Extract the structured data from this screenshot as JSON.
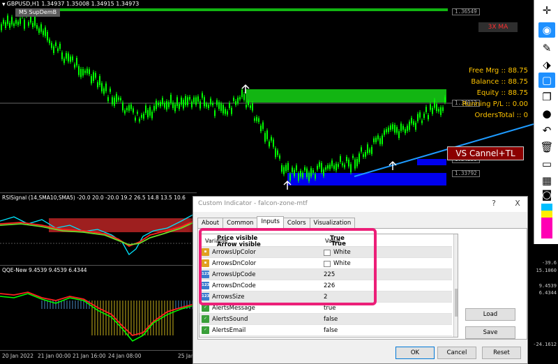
{
  "chart": {
    "header": "GBPUSD,H1  1.34937 1.35008 1.34915 1.34973",
    "sup_label": "M5 SupDemB",
    "ma_label": "3X MA",
    "price_tags": [
      "1.36549",
      "1.34913",
      "1.34250",
      "1.33792"
    ],
    "account": {
      "free_margin": "Free Mrg  :: 88.75",
      "balance": "Balance :: 88.75",
      "equity": "Equity :: 88.75",
      "running_pl": "Running P/L :: 0.00",
      "orders_total": "OrdersTotal :: 0"
    },
    "vs_label": "VS Cannel+TL",
    "colors": {
      "zone_green": "#12b512",
      "zone_blue": "#0000ee",
      "candle": "#00ff00",
      "trendline": "#1e9bff",
      "account_text": "#ffc400"
    }
  },
  "subwindows": {
    "rsi_title": "RSISignal (14,SMA10,SMA5) -20.0 20.0 -20.0 19.2 26.5 14.8 13.5 10.6",
    "qqe_title": "QQE-New 9.4539 9.4539 6.4344"
  },
  "price_axis": [
    "-39.6",
    "15.1060",
    "9.4539",
    "6.4344",
    "-24.1612"
  ],
  "time_axis": [
    "20 Jan 2022",
    "21 Jan 00:00",
    "21 Jan 16:00",
    "24 Jan 08:00",
    "25 Jan"
  ],
  "dialog": {
    "title": "Custom Indicator - falcon-zone-mtf",
    "controls": {
      "help": "?",
      "close": "X"
    },
    "tabs": [
      "About",
      "Common",
      "Inputs",
      "Colors",
      "Visualization"
    ],
    "grid": {
      "header_variable": "Variable",
      "header_value": "Value",
      "overlay": {
        "line1_name": "Price visible",
        "line1_value": "True",
        "line2_name": "Arrow visible",
        "line2_value": "True"
      },
      "rows": [
        {
          "icon": "col",
          "icon_text": "▪",
          "name": "ArrowsUpColor",
          "value": "White",
          "swatch": true
        },
        {
          "icon": "col",
          "icon_text": "▪",
          "name": "ArrowsDnColor",
          "value": "White",
          "swatch": true
        },
        {
          "icon": "num",
          "icon_text": "123",
          "name": "ArrowsUpCode",
          "value": "225"
        },
        {
          "icon": "num",
          "icon_text": "123",
          "name": "ArrowsDnCode",
          "value": "226"
        },
        {
          "icon": "num",
          "icon_text": "123",
          "name": "ArrowsSize",
          "value": "2"
        },
        {
          "icon": "bool",
          "icon_text": "✓",
          "name": "AlertsMessage",
          "value": "true"
        },
        {
          "icon": "bool",
          "icon_text": "✓",
          "name": "AlertsSound",
          "value": "false"
        },
        {
          "icon": "bool",
          "icon_text": "✓",
          "name": "AlertsEmail",
          "value": "false"
        }
      ]
    },
    "buttons": {
      "load": "Load",
      "save": "Save",
      "ok": "OK",
      "cancel": "Cancel",
      "reset": "Reset"
    }
  },
  "toolbar_icons": [
    "crosshair-icon",
    "eye-icon",
    "pencil-icon",
    "eraser-icon",
    "rectangle-icon",
    "copy-icon",
    "dot-icon",
    "undo-icon",
    "trash-icon",
    "monitor-icon",
    "calendar-icon",
    "camera-icon"
  ]
}
